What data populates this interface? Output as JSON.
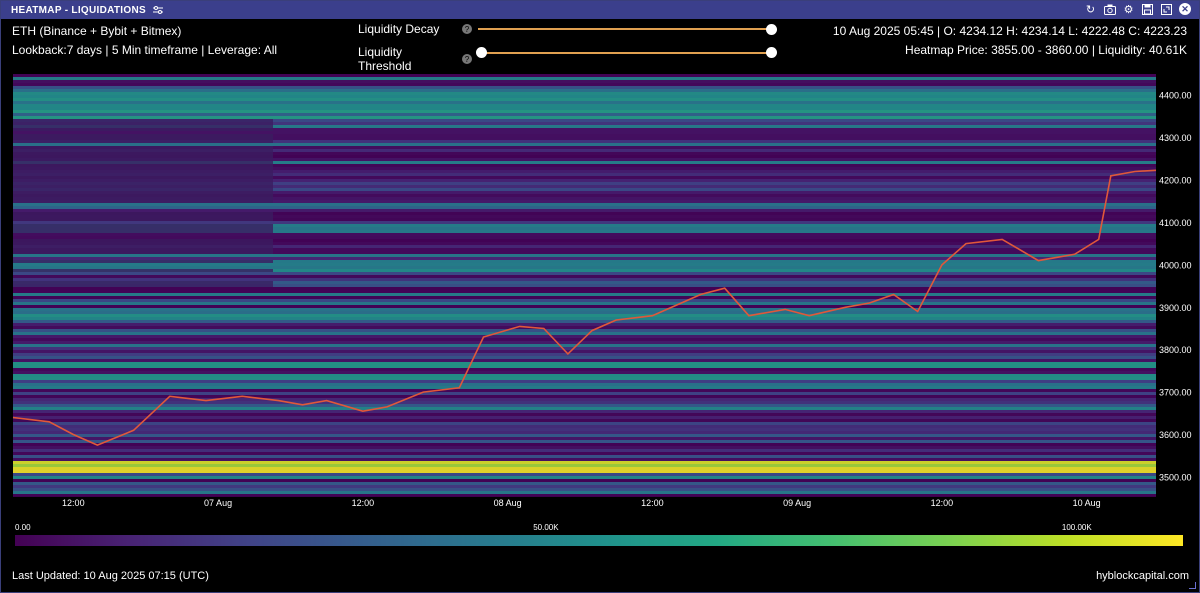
{
  "window": {
    "title": "HEATMAP - LIQUIDATIONS",
    "tool_icons": [
      "refresh-icon",
      "camera-icon",
      "gear-icon",
      "save-icon",
      "expand-icon",
      "close-icon"
    ]
  },
  "header": {
    "line1": "ETH (Binance + Bybit + Bitmex)",
    "line2": "Lookback:7 days | 5 Min timeframe | Leverage: All",
    "ohlc": "10 Aug 2025 05:45 | O: 4234.12 H: 4234.14 L: 4222.48 C: 4223.23",
    "heatmap_info": "Heatmap Price: 3855.00 - 3860.00 | Liquidity: 40.61K"
  },
  "controls": {
    "decay_label": "Liquidity Decay",
    "decay_value": 1.0,
    "threshold_label": "Liquidity Threshold",
    "threshold_range": [
      0.0,
      1.0
    ],
    "help_symbol": "?"
  },
  "chart_data": {
    "type": "heatmap",
    "title": "",
    "xlabel": "",
    "ylabel": "",
    "x_ticks": [
      "12:00",
      "07 Aug",
      "12:00",
      "08 Aug",
      "12:00",
      "09 Aug",
      "12:00",
      "10 Aug"
    ],
    "y_ticks": [
      "4400.00",
      "4300.00",
      "4200.00",
      "4100.00",
      "4000.00",
      "3900.00",
      "3800.00",
      "3700.00",
      "3600.00",
      "3500.00"
    ],
    "ylim": [
      3455,
      4450
    ],
    "time_range": [
      "2025-08-06T07:00",
      "2025-08-10T05:45"
    ],
    "colorbar": {
      "ticks": [
        "0.00",
        "50.00K",
        "100.00K"
      ],
      "range": [
        0,
        110000
      ]
    },
    "price_series": {
      "name": "",
      "color": "#e0583a",
      "x": [
        "06 Aug 07:00",
        "06 Aug 10:00",
        "06 Aug 12:00",
        "06 Aug 14:00",
        "06 Aug 17:00",
        "06 Aug 20:00",
        "06 Aug 23:00",
        "07 Aug 02:00",
        "07 Aug 05:00",
        "07 Aug 07:00",
        "07 Aug 09:00",
        "07 Aug 12:00",
        "07 Aug 14:00",
        "07 Aug 17:00",
        "07 Aug 20:00",
        "07 Aug 22:00",
        "08 Aug 01:00",
        "08 Aug 03:00",
        "08 Aug 05:00",
        "08 Aug 07:00",
        "08 Aug 09:00",
        "08 Aug 12:00",
        "08 Aug 14:00",
        "08 Aug 16:00",
        "08 Aug 18:00",
        "08 Aug 20:00",
        "08 Aug 23:00",
        "09 Aug 01:00",
        "09 Aug 04:00",
        "09 Aug 06:00",
        "09 Aug 08:00",
        "09 Aug 10:00",
        "09 Aug 12:00",
        "09 Aug 14:00",
        "09 Aug 17:00",
        "09 Aug 20:00",
        "09 Aug 23:00",
        "10 Aug 01:00",
        "10 Aug 02:00",
        "10 Aug 04:00",
        "10 Aug 05:45"
      ],
      "values": [
        3640,
        3630,
        3600,
        3575,
        3610,
        3690,
        3680,
        3690,
        3680,
        3670,
        3680,
        3655,
        3665,
        3700,
        3710,
        3830,
        3855,
        3850,
        3790,
        3845,
        3870,
        3880,
        3905,
        3930,
        3945,
        3880,
        3895,
        3880,
        3900,
        3910,
        3930,
        3890,
        4000,
        4050,
        4060,
        4010,
        4025,
        4060,
        4210,
        4220,
        4223
      ]
    }
  },
  "footer": {
    "updated": "Last Updated: 10 Aug 2025 07:15 (UTC)",
    "brand": "hyblockcapital.com"
  }
}
